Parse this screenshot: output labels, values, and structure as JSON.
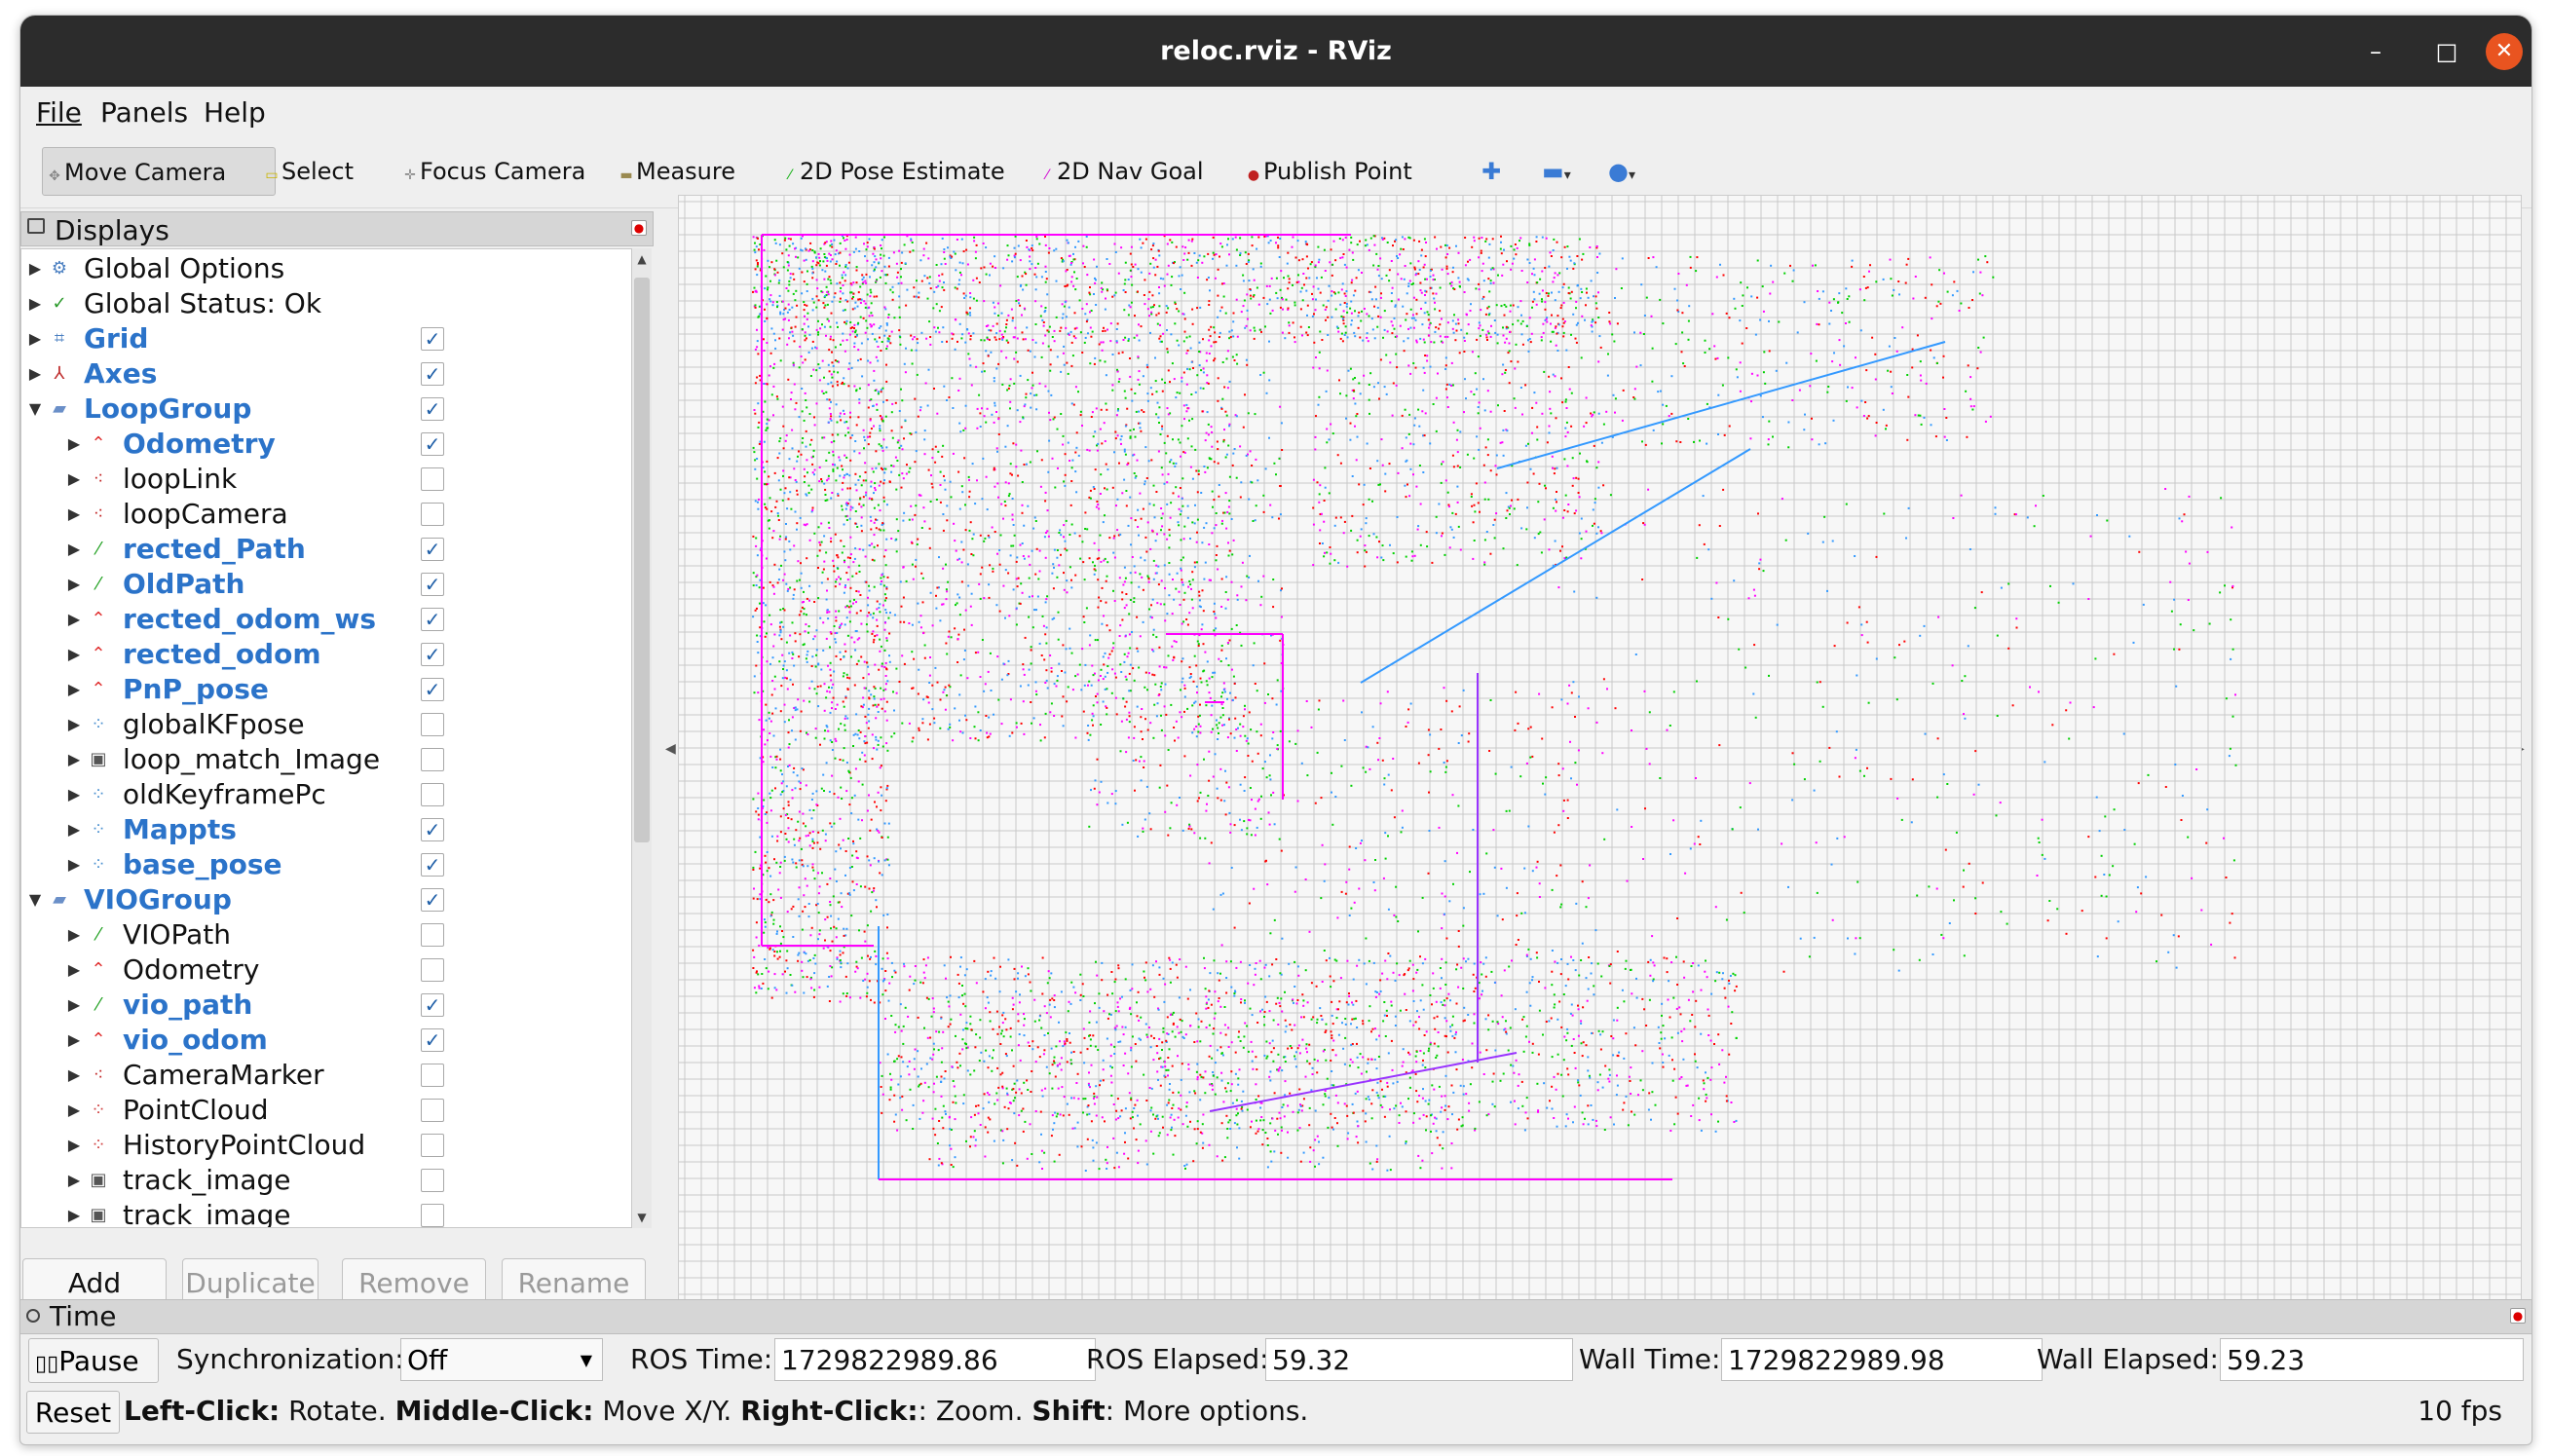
{
  "window": {
    "title": "reloc.rviz - RViz",
    "close_color": "#e95420"
  },
  "menu": [
    "File",
    "Panels",
    "Help"
  ],
  "toolbar": {
    "tools": [
      {
        "label": "Move Camera",
        "icon": "move-camera-icon"
      },
      {
        "label": "Select",
        "icon": "select-icon"
      },
      {
        "label": "Focus Camera",
        "icon": "focus-camera-icon"
      },
      {
        "label": "Measure",
        "icon": "measure-icon"
      },
      {
        "label": "2D Pose Estimate",
        "icon": "pose-estimate-icon"
      },
      {
        "label": "2D Nav Goal",
        "icon": "nav-goal-icon"
      },
      {
        "label": "Publish Point",
        "icon": "publish-point-icon"
      }
    ]
  },
  "displays": {
    "title": "Displays",
    "items": [
      {
        "label": "Global Options",
        "level": 0,
        "expanded": false,
        "checkbox": false,
        "checked": false,
        "icon": "gear-icon"
      },
      {
        "label": "Global Status: Ok",
        "level": 0,
        "expanded": false,
        "checkbox": false,
        "checked": false,
        "icon": "check-icon"
      },
      {
        "label": "Grid",
        "level": 0,
        "expanded": false,
        "checkbox": true,
        "checked": true,
        "icon": "grid-icon"
      },
      {
        "label": "Axes",
        "level": 0,
        "expanded": false,
        "checkbox": true,
        "checked": true,
        "icon": "axes-icon"
      },
      {
        "label": "LoopGroup",
        "level": 0,
        "expanded": true,
        "checkbox": true,
        "checked": true,
        "icon": "folder-icon"
      },
      {
        "label": "Odometry",
        "level": 1,
        "expanded": false,
        "checkbox": true,
        "checked": true,
        "icon": "odometry-icon"
      },
      {
        "label": "loopLink",
        "level": 1,
        "expanded": false,
        "checkbox": true,
        "checked": false,
        "icon": "marker-icon"
      },
      {
        "label": "loopCamera",
        "level": 1,
        "expanded": false,
        "checkbox": true,
        "checked": false,
        "icon": "marker-icon"
      },
      {
        "label": "rected_Path",
        "level": 1,
        "expanded": false,
        "checkbox": true,
        "checked": true,
        "icon": "path-icon"
      },
      {
        "label": "OldPath",
        "level": 1,
        "expanded": false,
        "checkbox": true,
        "checked": true,
        "icon": "path-icon"
      },
      {
        "label": "rected_odom_ws",
        "level": 1,
        "expanded": false,
        "checkbox": true,
        "checked": true,
        "icon": "odometry-icon"
      },
      {
        "label": "rected_odom",
        "level": 1,
        "expanded": false,
        "checkbox": true,
        "checked": true,
        "icon": "odometry-icon"
      },
      {
        "label": "PnP_pose",
        "level": 1,
        "expanded": false,
        "checkbox": true,
        "checked": true,
        "icon": "odometry-icon"
      },
      {
        "label": "globalKFpose",
        "level": 1,
        "expanded": false,
        "checkbox": true,
        "checked": false,
        "icon": "pointcloud-icon"
      },
      {
        "label": "loop_match_Image",
        "level": 1,
        "expanded": false,
        "checkbox": true,
        "checked": false,
        "icon": "image-icon"
      },
      {
        "label": "oldKeyframePc",
        "level": 1,
        "expanded": false,
        "checkbox": true,
        "checked": false,
        "icon": "pointcloud-icon"
      },
      {
        "label": "Mappts",
        "level": 1,
        "expanded": false,
        "checkbox": true,
        "checked": true,
        "icon": "pointcloud-icon"
      },
      {
        "label": "base_pose",
        "level": 1,
        "expanded": false,
        "checkbox": true,
        "checked": true,
        "icon": "pointcloud-icon"
      },
      {
        "label": "VIOGroup",
        "level": 0,
        "expanded": true,
        "checkbox": true,
        "checked": true,
        "icon": "folder-icon"
      },
      {
        "label": "VIOPath",
        "level": 1,
        "expanded": false,
        "checkbox": true,
        "checked": false,
        "icon": "path-icon"
      },
      {
        "label": "Odometry",
        "level": 1,
        "expanded": false,
        "checkbox": true,
        "checked": false,
        "icon": "odometry-icon"
      },
      {
        "label": "vio_path",
        "level": 1,
        "expanded": false,
        "checkbox": true,
        "checked": true,
        "icon": "path-icon"
      },
      {
        "label": "vio_odom",
        "level": 1,
        "expanded": false,
        "checkbox": true,
        "checked": true,
        "icon": "odometry-icon"
      },
      {
        "label": "CameraMarker",
        "level": 1,
        "expanded": false,
        "checkbox": true,
        "checked": false,
        "icon": "marker-icon"
      },
      {
        "label": "PointCloud",
        "level": 1,
        "expanded": false,
        "checkbox": true,
        "checked": false,
        "icon": "pointcloud-red-icon"
      },
      {
        "label": "HistoryPointCloud",
        "level": 1,
        "expanded": false,
        "checkbox": true,
        "checked": false,
        "icon": "pointcloud-red-icon"
      },
      {
        "label": "track_image",
        "level": 1,
        "expanded": false,
        "checkbox": true,
        "checked": false,
        "icon": "image-icon"
      },
      {
        "label": "track_image",
        "level": 1,
        "expanded": false,
        "checkbox": true,
        "checked": false,
        "icon": "image-icon"
      }
    ],
    "buttons": {
      "add": "Add",
      "duplicate": "Duplicate",
      "remove": "Remove",
      "rename": "Rename"
    }
  },
  "time": {
    "title": "Time",
    "pause_label": "Pause",
    "sync_label": "Synchronization:",
    "sync_value": "Off",
    "ros_time_label": "ROS Time:",
    "ros_time": "1729822989.86",
    "ros_elapsed_label": "ROS Elapsed:",
    "ros_elapsed": "59.32",
    "wall_time_label": "Wall Time:",
    "wall_time": "1729822989.98",
    "wall_elapsed_label": "Wall Elapsed:",
    "wall_elapsed": "59.23"
  },
  "status": {
    "reset_label": "Reset",
    "hint": [
      {
        "b": "Left-Click:",
        "t": " Rotate. "
      },
      {
        "b": "Middle-Click:",
        "t": " Move X/Y. "
      },
      {
        "b": "Right-Click:",
        "t": ": Zoom. "
      },
      {
        "b": "Shift",
        "t": ": More options."
      }
    ],
    "fps": "10 fps"
  },
  "colors": {
    "accent": "#2b73c9",
    "grid": "#c8c8c8",
    "points": [
      "#ff00ff",
      "#00d000",
      "#ff0000",
      "#3399ff"
    ]
  }
}
